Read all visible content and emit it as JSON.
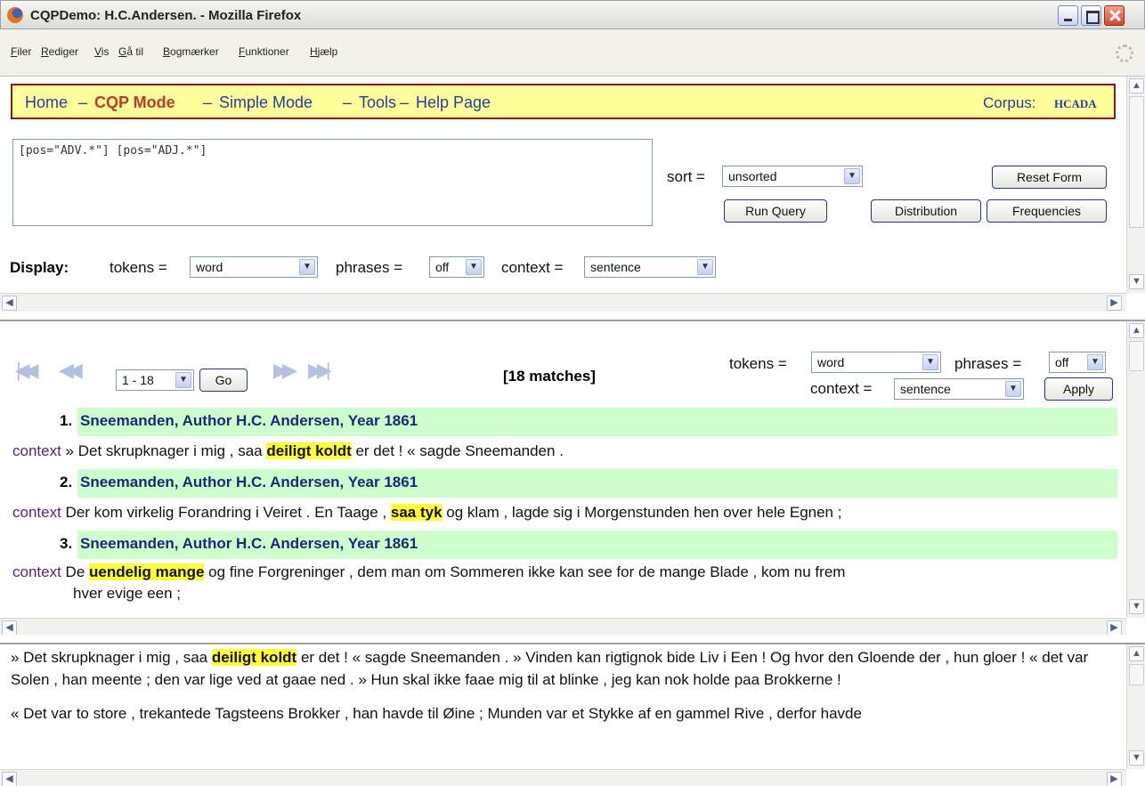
{
  "window": {
    "title": "CQPDemo: H.C.Andersen. - Mozilla Firefox"
  },
  "menu": [
    "Filer",
    "Rediger",
    "Vis",
    "Gå til",
    "Bogmærker",
    "Funktioner",
    "Hjælp"
  ],
  "nav": {
    "home": "Home",
    "cqp": "CQP Mode",
    "simple": "Simple Mode",
    "tools": "Tools",
    "help": "Help Page",
    "sep": "–",
    "corpus_label": "Corpus:",
    "corpus_value": "HCADA"
  },
  "query": {
    "text": "[pos=\"ADV.*\"] [pos=\"ADJ.*\"]",
    "sort_label": "sort =",
    "sort_value": "unsorted",
    "reset": "Reset Form",
    "run": "Run Query",
    "distribution": "Distribution",
    "frequencies": "Frequencies"
  },
  "display": {
    "label": "Display:",
    "tokens_label": "tokens =",
    "tokens_value": "word",
    "phrases_label": "phrases =",
    "phrases_value": "off",
    "context_label": "context =",
    "context_value": "sentence"
  },
  "results": {
    "range": "1 - 18",
    "go": "Go",
    "matches": "[18 matches]",
    "tokens_label": "tokens =",
    "tokens_value": "word",
    "phrases_label": "phrases =",
    "phrases_value": "off",
    "context_label": "context =",
    "context_value": "sentence",
    "apply": "Apply",
    "context_link": "context",
    "items": [
      {
        "num": "1.",
        "title": "Sneemanden, Author H.C. Andersen, Year 1861",
        "pre": " » Det skrupknager i mig , saa ",
        "hit": "deiligt koldt",
        "post": " er det ! « sagde Sneemanden ."
      },
      {
        "num": "2.",
        "title": "Sneemanden, Author H.C. Andersen, Year 1861",
        "pre": " Der kom virkelig Forandring i Veiret .  En Taage , ",
        "hit": "saa tyk",
        "post": " og klam , lagde sig i Morgenstunden hen over hele Egnen ;"
      },
      {
        "num": "3.",
        "title": "Sneemanden, Author H.C. Andersen, Year 1861",
        "pre": " De ",
        "hit": "uendelig mange",
        "post": " og fine Forgreninger , dem man om Sommeren ikke kan see for de mange Blade , kom nu frem",
        "post2": "hver evige een ;"
      }
    ]
  },
  "context_frame": {
    "p1_pre": "» Det skrupknager i mig , saa ",
    "p1_hit": "deiligt koldt",
    "p1_post": " er det ! « sagde Sneemanden . » Vinden kan rigtignok bide Liv i Een !  Og hvor den Gloende der , hun gloer ! « det var Solen , han meente ;  den var lige ved at gaae ned . » Hun skal ikke faae mig til at blinke , jeg kan nok holde paa Brokkerne !",
    "p2": "« Det var to store , trekantede Tagsteens Brokker , han havde til Øine ;  Munden var et Stykke af en gammel Rive , derfor havde"
  }
}
